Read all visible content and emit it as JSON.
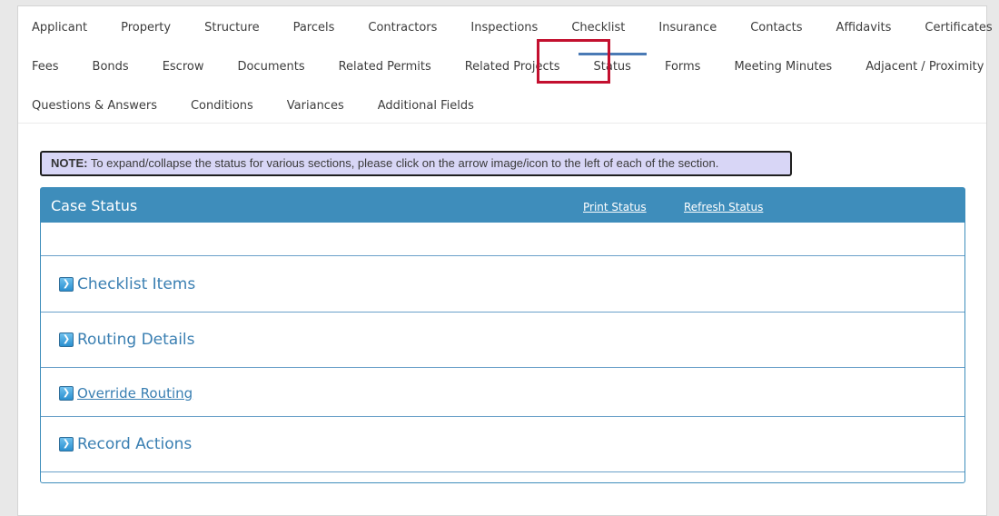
{
  "tabs": {
    "row1": [
      "Applicant",
      "Property",
      "Structure",
      "Parcels",
      "Contractors",
      "Inspections",
      "Checklist",
      "Insurance",
      "Contacts",
      "Affidavits",
      "Certificates"
    ],
    "row2": [
      "Fees",
      "Bonds",
      "Escrow",
      "Documents",
      "Related Permits",
      "Related Projects",
      "Status",
      "Forms",
      "Meeting Minutes",
      "Adjacent / Proximity"
    ],
    "row3": [
      "Questions & Answers",
      "Conditions",
      "Variances",
      "Additional Fields"
    ],
    "active": "Status"
  },
  "note": {
    "label": "NOTE:",
    "text": " To expand/collapse the status for various sections, please click on the arrow image/icon to the left of each of the section."
  },
  "case_status": {
    "title": "Case Status",
    "print_link": "Print Status",
    "refresh_link": "Refresh Status",
    "sections": [
      "Checklist Items",
      "Routing Details",
      "Override Routing",
      "Record Actions"
    ]
  },
  "colors": {
    "header_blue": "#3e8dbb",
    "active_highlight": "#c3102f",
    "note_bg": "#d8d6f6"
  },
  "icons": {
    "expand": "chevron-right-icon"
  }
}
